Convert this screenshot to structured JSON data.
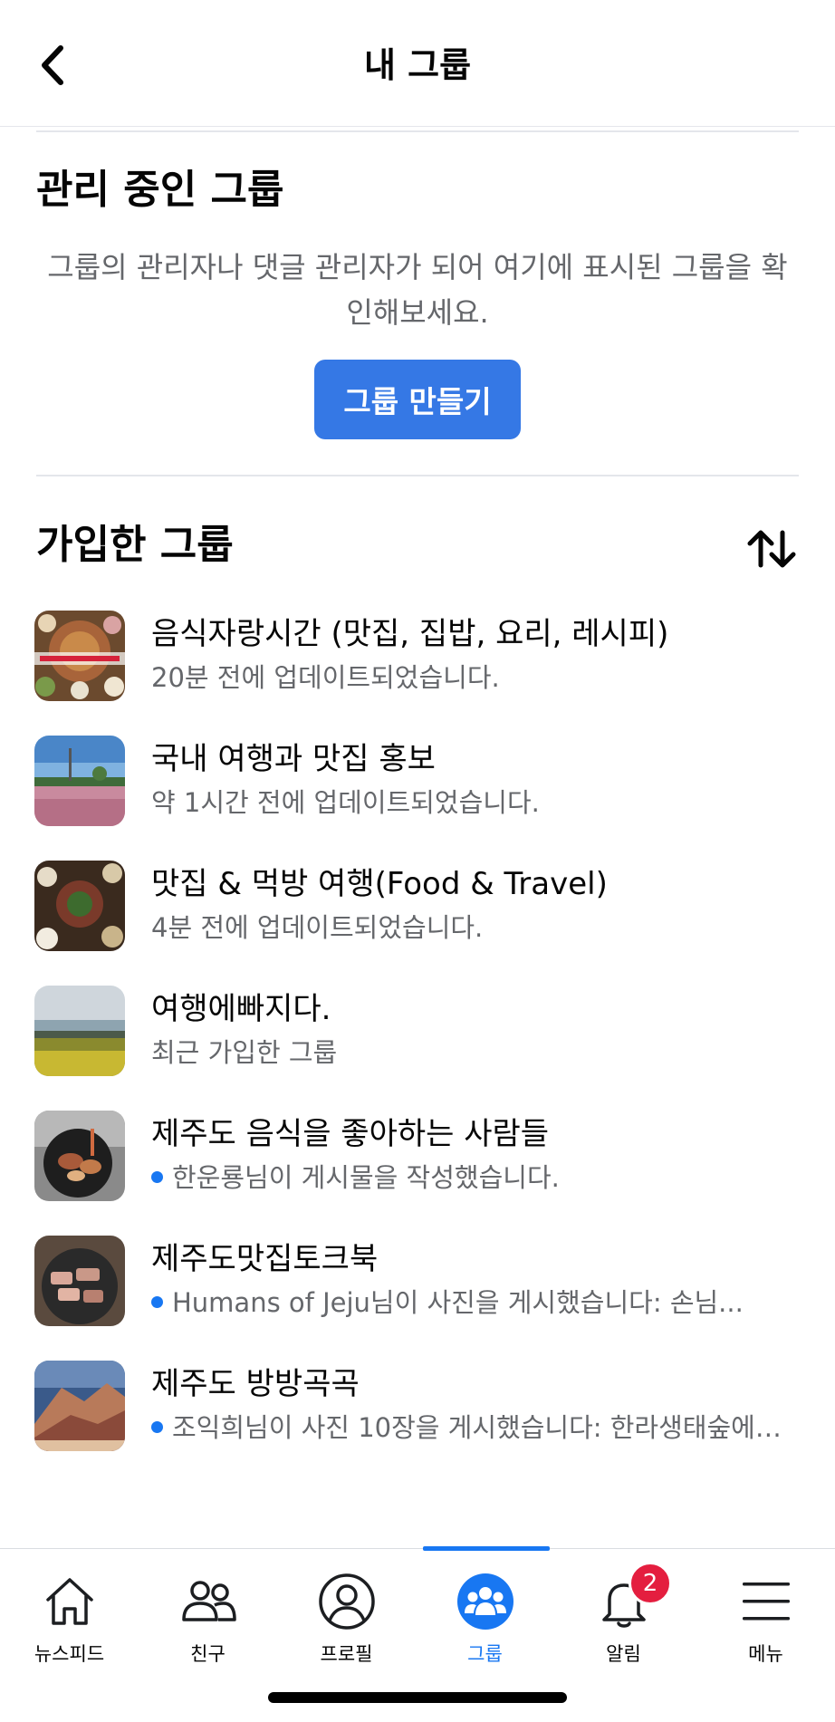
{
  "header": {
    "title": "내 그룹"
  },
  "managed": {
    "title": "관리 중인 그룹",
    "description": "그룹의 관리자나 댓글 관리자가 되어 여기에 표시된 그룹을 확인해보세요.",
    "create_button": "그룹 만들기"
  },
  "joined": {
    "title": "가입한 그룹",
    "groups": [
      {
        "name": "음식자랑시간 (맛집, 집밥, 요리, 레시피)",
        "subtitle": "20분 전에 업데이트되었습니다.",
        "unread": false,
        "thumb": "food-platter"
      },
      {
        "name": "국내 여행과 맛집 홍보",
        "subtitle": "약 1시간 전에 업데이트되었습니다.",
        "unread": false,
        "thumb": "pink-field"
      },
      {
        "name": "맛집 & 먹방 여행(Food & Travel)",
        "subtitle": "4분 전에 업데이트되었습니다.",
        "unread": false,
        "thumb": "korean-table"
      },
      {
        "name": "여행에빠지다.",
        "subtitle": "최근 가입한 그룹",
        "unread": false,
        "thumb": "canola-coast"
      },
      {
        "name": "제주도 음식을 좋아하는 사람들",
        "subtitle": "한운룡님이 게시물을 작성했습니다.",
        "unread": true,
        "thumb": "grill-pan"
      },
      {
        "name": "제주도맛집토크북",
        "subtitle": "Humans of Jeju님이 사진을 게시했습니다: 손님...",
        "unread": true,
        "thumb": "pork-grill"
      },
      {
        "name": "제주도 방방곡곡",
        "subtitle": "조익희님이 사진 10장을 게시했습니다: 한라생태숲에…",
        "unread": true,
        "thumb": "mountain"
      }
    ]
  },
  "nav": {
    "items": [
      {
        "label": "뉴스피드",
        "icon": "home-icon"
      },
      {
        "label": "친구",
        "icon": "friends-icon"
      },
      {
        "label": "프로필",
        "icon": "profile-icon"
      },
      {
        "label": "그룹",
        "icon": "groups-icon"
      },
      {
        "label": "알림",
        "icon": "bell-icon"
      },
      {
        "label": "메뉴",
        "icon": "menu-icon"
      }
    ],
    "notification_badge": "2",
    "active": "그룹"
  },
  "colors": {
    "accent": "#1877f2",
    "button": "#3578e5",
    "badge": "#e41e3f",
    "secondary_text": "#65676b"
  }
}
